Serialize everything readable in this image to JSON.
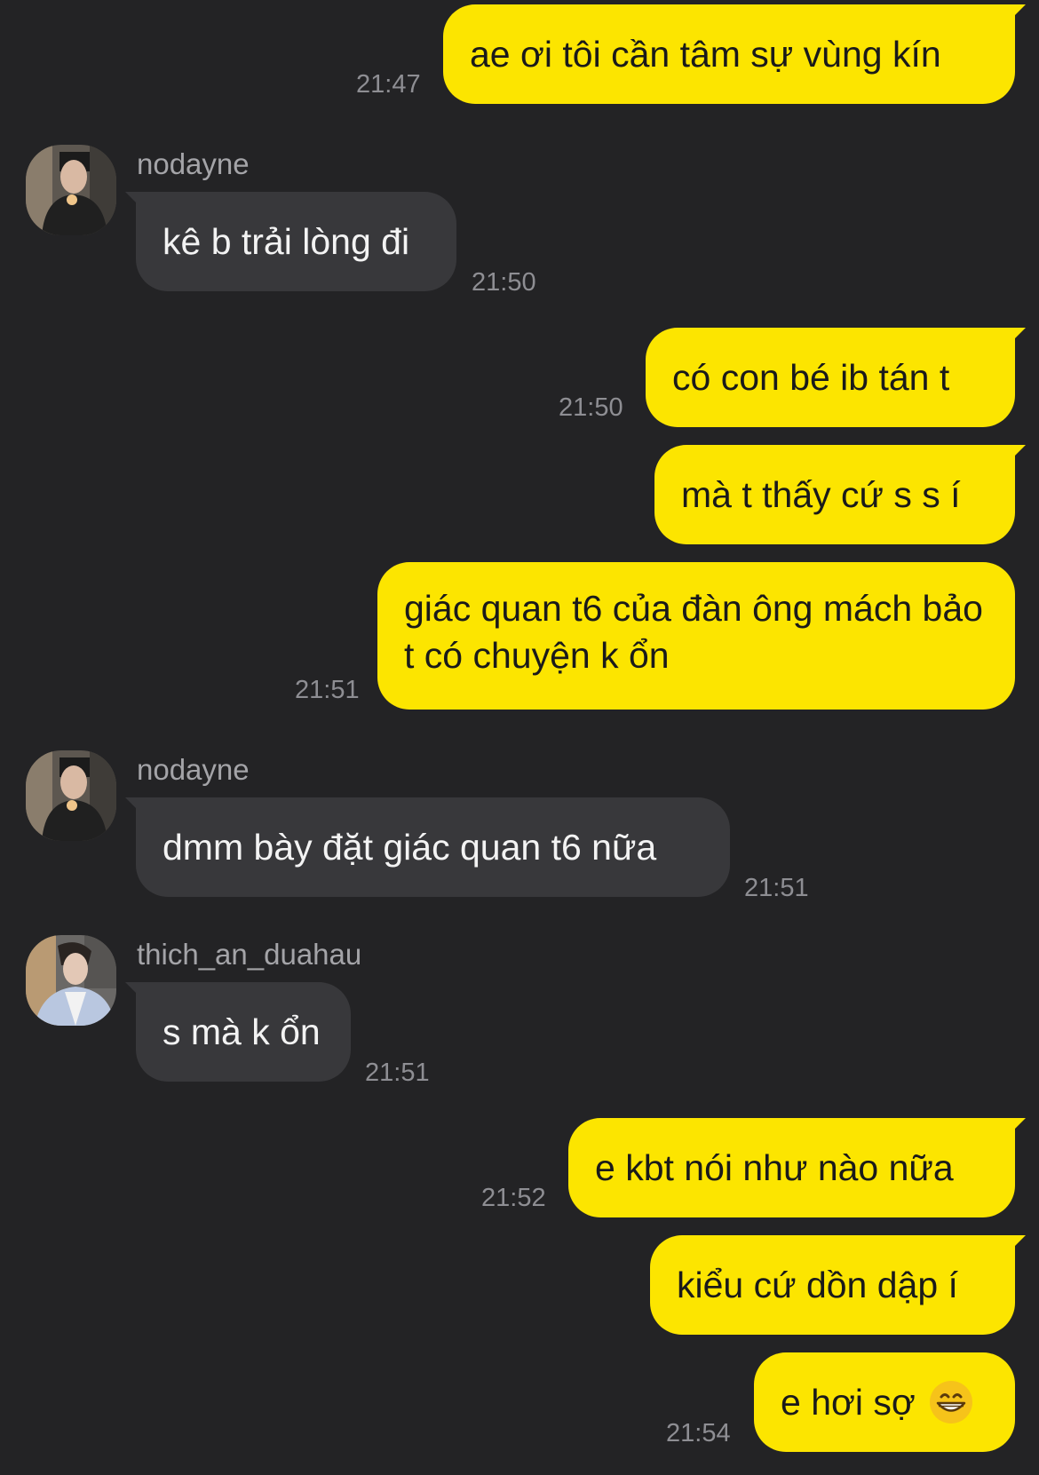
{
  "messages": [
    {
      "text": "ae ơi tôi cần tâm sự vùng kín",
      "time": "21:47"
    },
    {
      "sender": "nodayne",
      "text": "kê b trải lòng đi",
      "time": "21:50"
    },
    {
      "text": "có con bé ib tán t",
      "time": "21:50"
    },
    {
      "text": "mà t thấy cứ s s í"
    },
    {
      "text": "giác quan t6 của đàn ông mách bảo t có chuyện k ổn",
      "time": "21:51"
    },
    {
      "sender": "nodayne",
      "text": "dmm bày đặt giác quan t6 nữa",
      "time": "21:51"
    },
    {
      "sender": "thich_an_duahau",
      "text": "s mà k ổn",
      "time": "21:51"
    },
    {
      "text": "e kbt nói như nào nữa",
      "time": "21:52"
    },
    {
      "text": "kiểu cứ dồn dập í"
    },
    {
      "text": "e hơi sợ",
      "emoji": "grinning-face-emoji",
      "time": "21:54"
    }
  ],
  "colors": {
    "background": "#232325",
    "outgoing_bubble": "#fce500",
    "incoming_bubble": "#38383b",
    "timestamp": "#8e8e93"
  }
}
